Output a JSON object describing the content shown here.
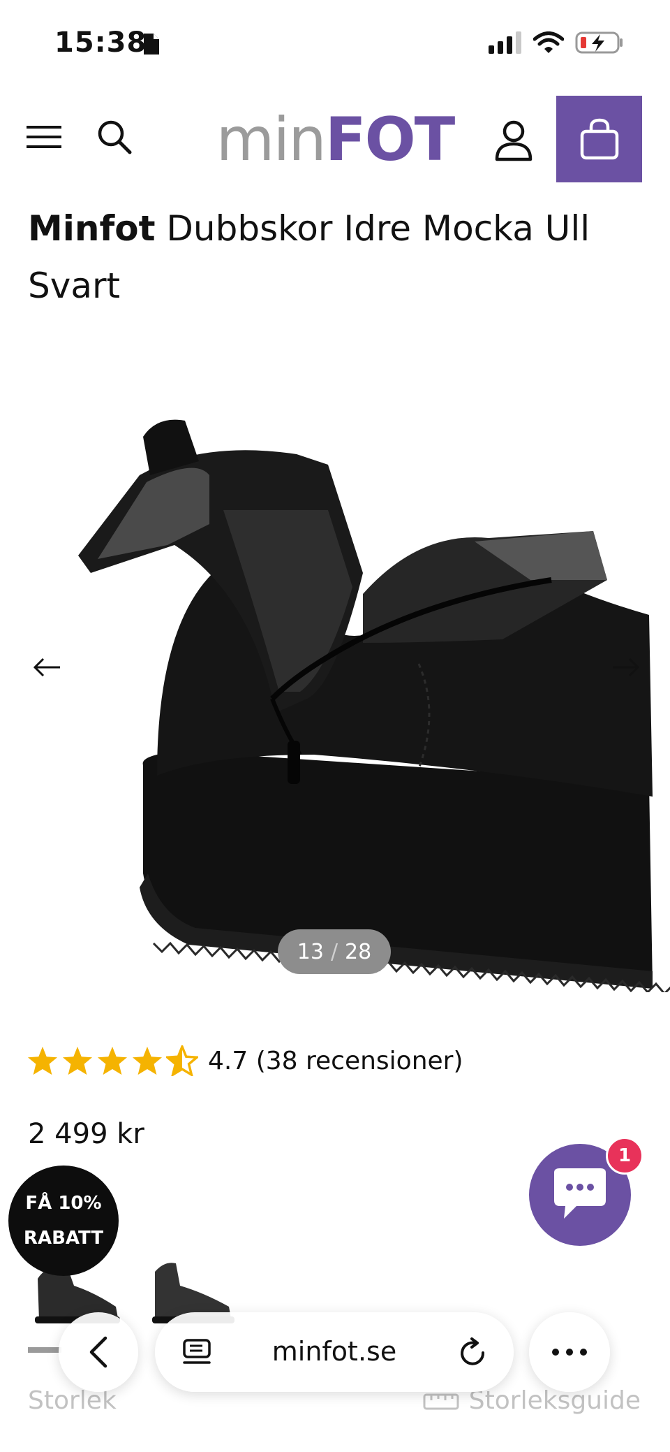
{
  "status": {
    "time": "15:38"
  },
  "header": {
    "logo_part1": "min",
    "logo_part2": "FOT"
  },
  "product": {
    "brand": "Minfot",
    "name": "Dubbskor Idre Mocka Ull Svart",
    "image_counter": {
      "current": "13",
      "separator": "/",
      "total": "28"
    },
    "rating": {
      "stars": 4.5,
      "text": "4.7 (38 recensioner)"
    },
    "price": "2 499 kr",
    "size_label": "Storlek",
    "size_guide": "Storleksguide"
  },
  "promo": {
    "line1": "FÅ 10%",
    "line2": "RABATT"
  },
  "chat": {
    "badge_count": "1"
  },
  "browser": {
    "url": "minfot.se"
  },
  "colors": {
    "brand": "#6b51a3",
    "star": "#f5b301",
    "badge": "#e8325a"
  },
  "icons": [
    "menu-icon",
    "search-icon",
    "account-icon",
    "shopping-bag-icon",
    "arrow-left-icon",
    "arrow-right-icon",
    "star-icon",
    "chat-icon",
    "back-icon",
    "reader-icon",
    "reload-icon",
    "more-icon",
    "ruler-icon"
  ]
}
